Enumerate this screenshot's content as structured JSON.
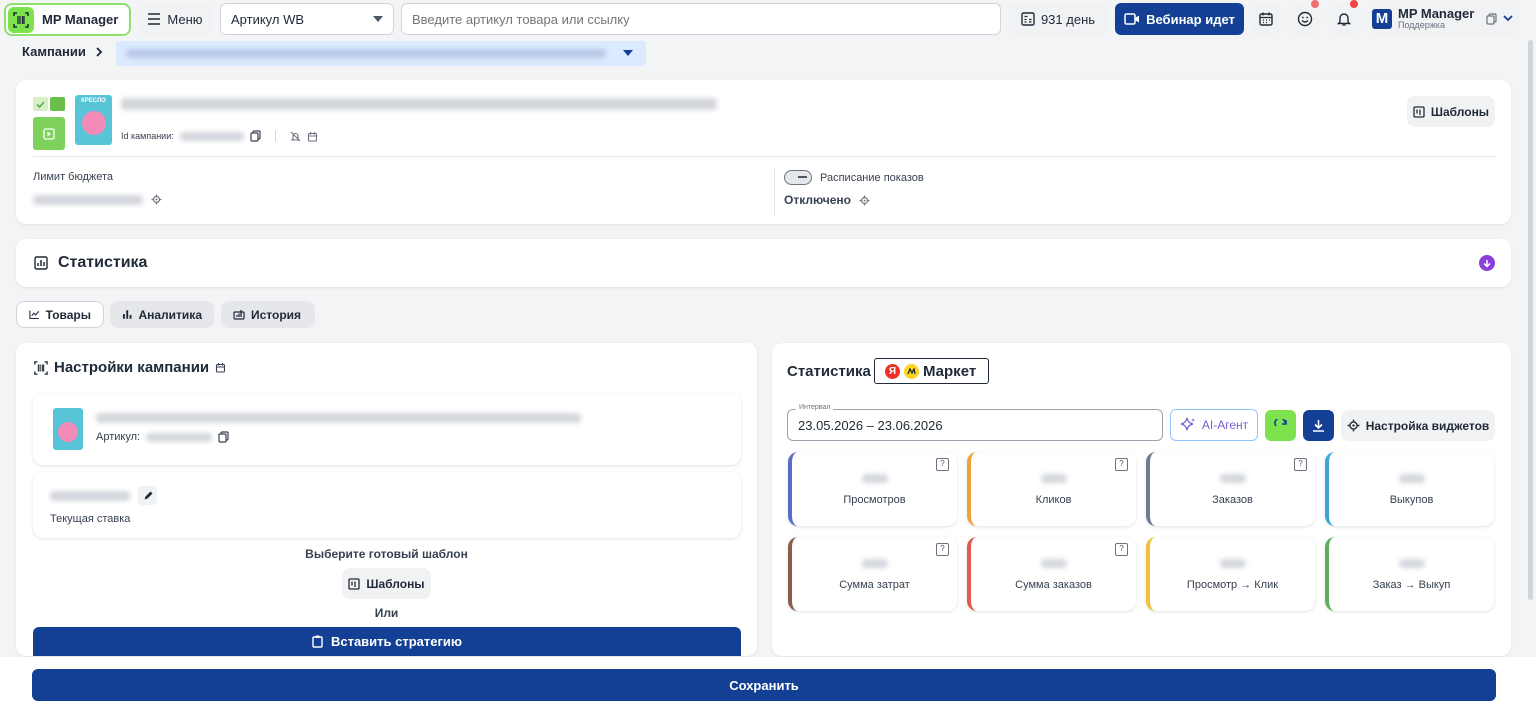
{
  "app": {
    "name": "MP Manager"
  },
  "topbar": {
    "menu_label": "Меню",
    "article_select": "Артикул WB",
    "search_placeholder": "Введите артикул товара или ссылку",
    "days_label": "931 день",
    "webinar_label": "Вебинар идет",
    "profile_name": "MP Manager",
    "profile_sub": "Поддержка",
    "profile_initial": "M"
  },
  "breadcrumb": {
    "root": "Кампании"
  },
  "campaign": {
    "thumb_text": "КРЕСЛО",
    "id_label": "Id кампании:",
    "templates_label": "Шаблоны",
    "budget_label": "Лимит бюджета",
    "schedule_label": "Расписание показов",
    "schedule_value": "Отключено"
  },
  "stats_section": {
    "title": "Статистика"
  },
  "tabs": [
    {
      "label": "Товары"
    },
    {
      "label": "Аналитика"
    },
    {
      "label": "История"
    }
  ],
  "settings": {
    "title": "Настройки кампании",
    "article_label": "Артикул:",
    "current_bid_label": "Текущая ставка",
    "choose_template": "Выберите готовый шаблон",
    "templates_label": "Шаблоны",
    "or": "Или",
    "insert_strategy": "Вставить стратегию"
  },
  "right_stats": {
    "title": "Статистика",
    "market_label": "Маркет",
    "interval_label": "Интервал",
    "interval_value": "23.05.2026 – 23.06.2026",
    "ai_agent": "AI-Агент",
    "widget_settings": "Настройка виджетов",
    "help_glyph": "?",
    "metrics": [
      {
        "label": "Просмотров",
        "color": "#5b6bc7"
      },
      {
        "label": "Кликов",
        "color": "#f0a23c"
      },
      {
        "label": "Заказов",
        "color": "#6b7c93"
      },
      {
        "label": "Выкупов",
        "color": "#3aa7dc"
      },
      {
        "label": "Сумма затрат",
        "color": "#8b5e4a"
      },
      {
        "label": "Сумма заказов",
        "color": "#e05a4e"
      },
      {
        "label": "Просмотр → Клик",
        "color": "#f2c23b"
      },
      {
        "label": "Заказ → Выкуп",
        "color": "#5cae5c"
      }
    ]
  },
  "footer": {
    "save_label": "Сохранить"
  }
}
